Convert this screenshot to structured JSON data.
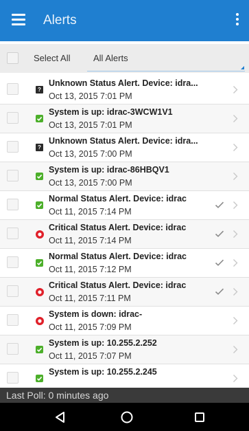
{
  "appbar": {
    "title": "Alerts",
    "menu_icon": "hamburger-menu-icon",
    "more_icon": "overflow-menu-icon"
  },
  "filter": {
    "select_all_label": "Select All",
    "dropdown_value": "All Alerts"
  },
  "colors": {
    "accent": "#1f7fd0",
    "ok": "#4caf2a",
    "critical": "#e0202a",
    "unknown": "#2b2b2b"
  },
  "alerts": [
    {
      "status": "unknown",
      "title": "Unknown Status Alert. Device: idra...",
      "time": "Oct 13, 2015 7:01 PM",
      "acknowledged": false
    },
    {
      "status": "ok",
      "title": "System is up: idrac-3WCW1V1",
      "time": "Oct 13, 2015 7:01 PM",
      "acknowledged": false
    },
    {
      "status": "unknown",
      "title": "Unknown Status Alert. Device: idra...",
      "time": "Oct 13, 2015 7:00 PM",
      "acknowledged": false
    },
    {
      "status": "ok",
      "title": "System is up: idrac-86HBQV1",
      "time": "Oct 13, 2015 7:00 PM",
      "acknowledged": false
    },
    {
      "status": "ok",
      "title": "Normal Status Alert. Device: idrac",
      "time": "Oct 11, 2015 7:14 PM",
      "acknowledged": true
    },
    {
      "status": "critical",
      "title": "Critical Status Alert. Device: idrac",
      "time": "Oct 11, 2015 7:14 PM",
      "acknowledged": true
    },
    {
      "status": "ok",
      "title": "Normal Status Alert. Device: idrac",
      "time": "Oct 11, 2015 7:12 PM",
      "acknowledged": true
    },
    {
      "status": "critical",
      "title": "Critical Status Alert. Device: idrac",
      "time": "Oct 11, 2015 7:11 PM",
      "acknowledged": true
    },
    {
      "status": "critical",
      "title": "System is down: idrac-",
      "time": "Oct 11, 2015 7:09 PM",
      "acknowledged": false
    },
    {
      "status": "ok",
      "title": "System is up: 10.255.2.252",
      "time": "Oct 11, 2015 7:07 PM",
      "acknowledged": false
    },
    {
      "status": "ok",
      "title": "System is up: 10.255.2.245",
      "time": "",
      "acknowledged": false
    }
  ],
  "footer": {
    "last_poll": "Last Poll: 0 minutes ago"
  },
  "navbar": {
    "back_icon": "back-triangle-icon",
    "home_icon": "home-circle-icon",
    "recents_icon": "recents-square-icon"
  }
}
